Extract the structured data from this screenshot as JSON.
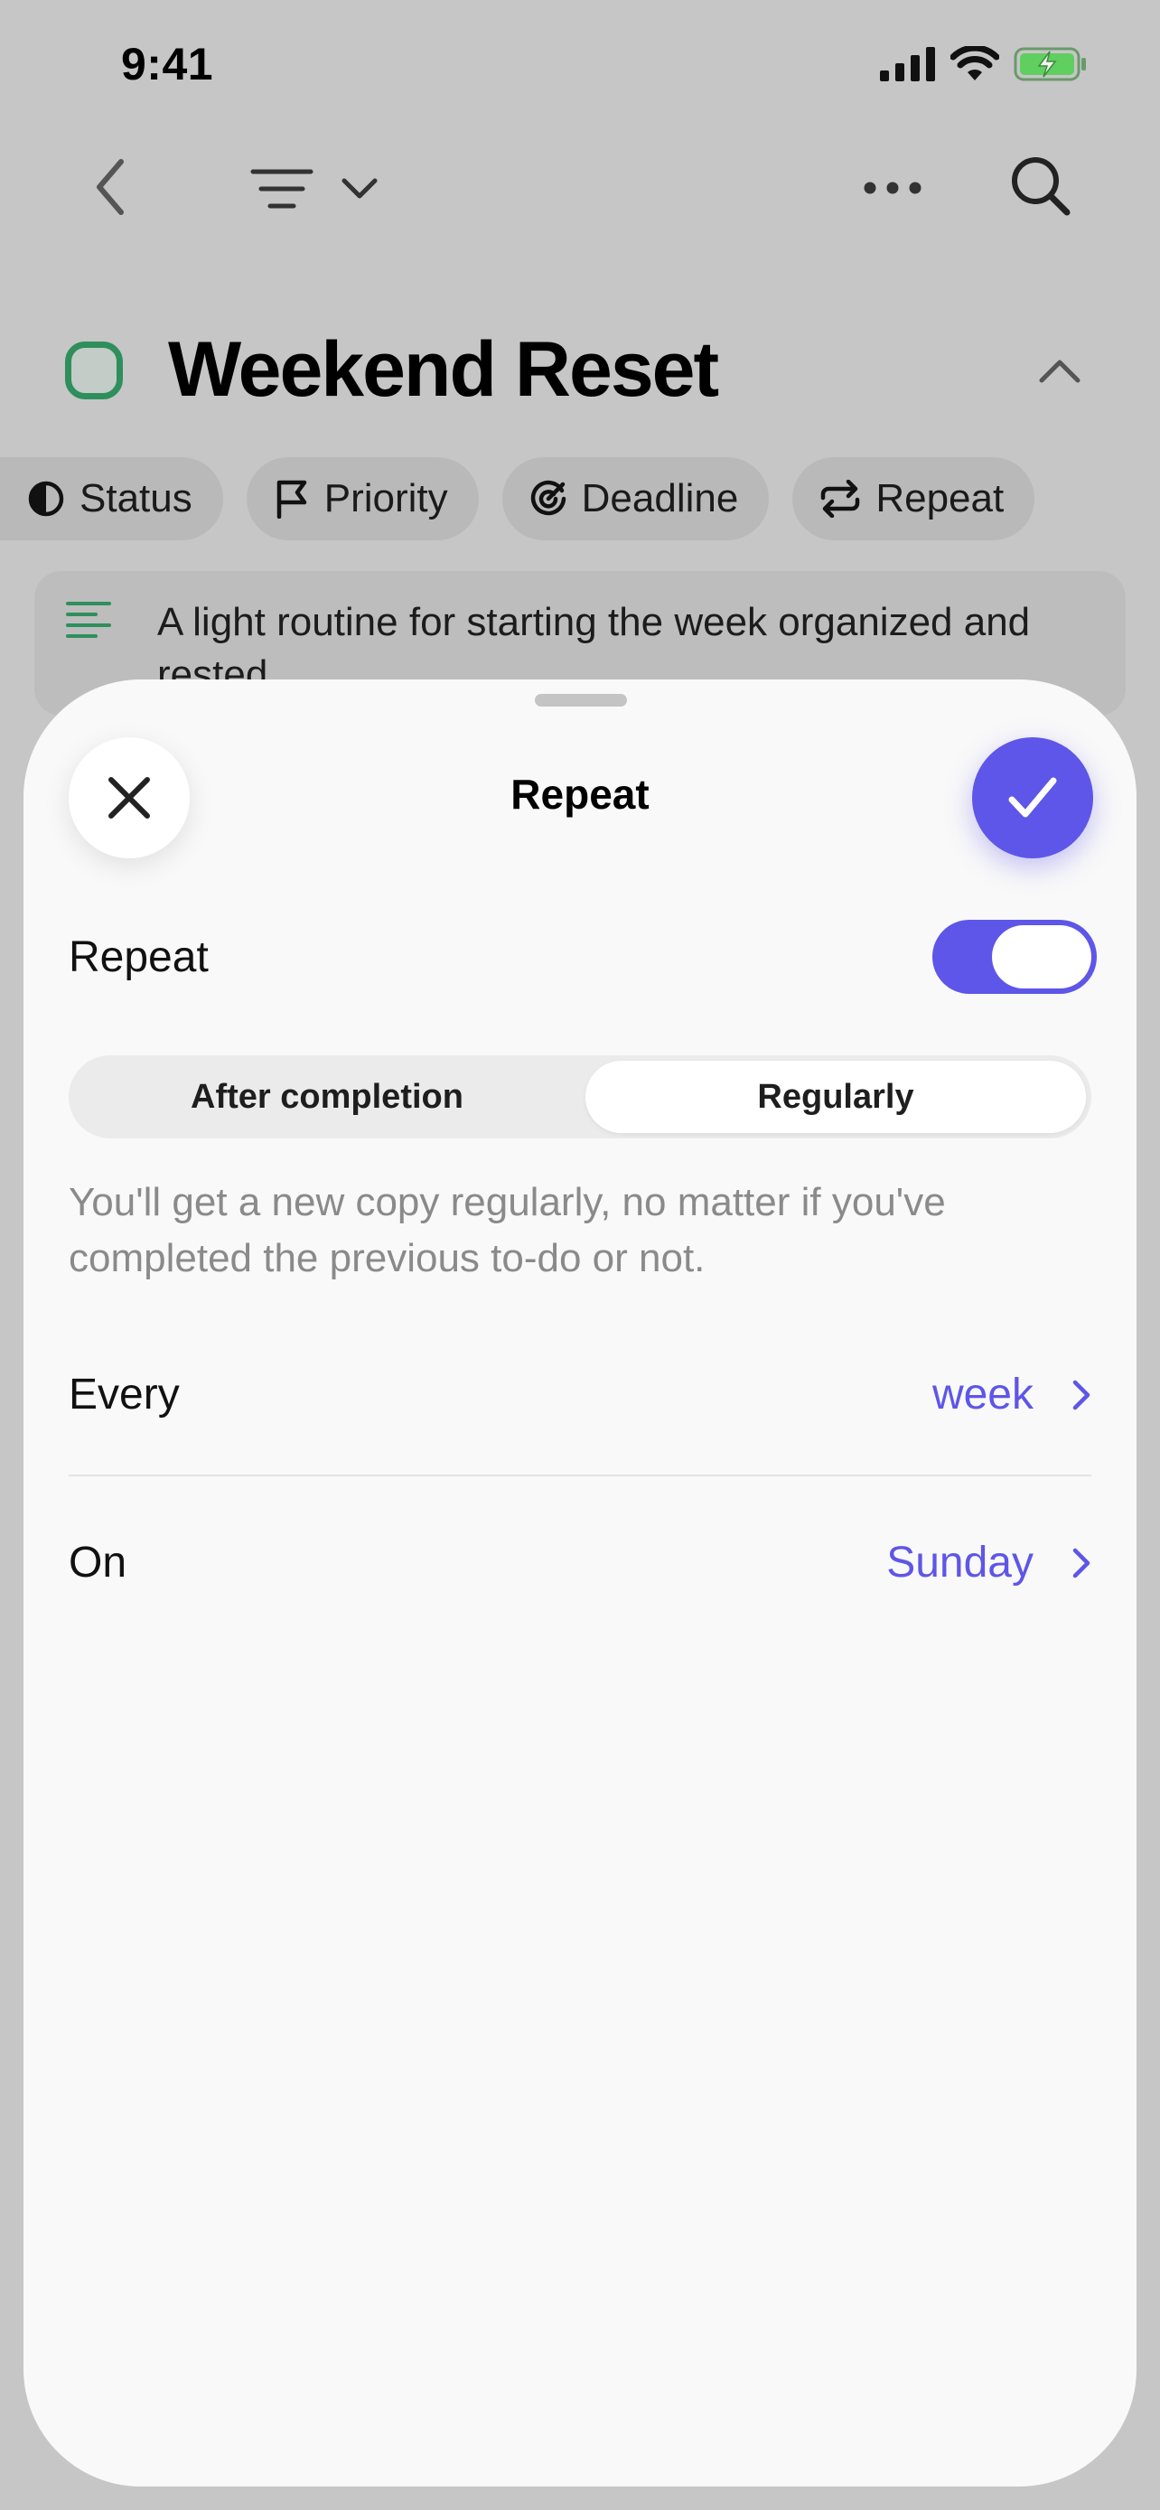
{
  "status_bar": {
    "time": "9:41"
  },
  "task": {
    "title": "Weekend Reset",
    "note": "A light routine for starting the week organized and rested.",
    "chips": [
      {
        "label": "Status",
        "icon": "half-circle-icon"
      },
      {
        "label": "Priority",
        "icon": "flag-icon"
      },
      {
        "label": "Deadline",
        "icon": "target-icon"
      },
      {
        "label": "Repeat",
        "icon": "repeat-icon"
      }
    ]
  },
  "sheet": {
    "title": "Repeat",
    "repeat_label": "Repeat",
    "repeat_enabled": true,
    "segments": [
      "After completion",
      "Regularly"
    ],
    "selected_segment": "Regularly",
    "description": "You'll get a new copy regularly, no matter if you've completed the previous to-do or not.",
    "every_label": "Every",
    "every_value": "week",
    "on_label": "On",
    "on_value": "Sunday"
  },
  "colors": {
    "accent": "#5e56e8",
    "task_green": "#2e8f5c"
  }
}
